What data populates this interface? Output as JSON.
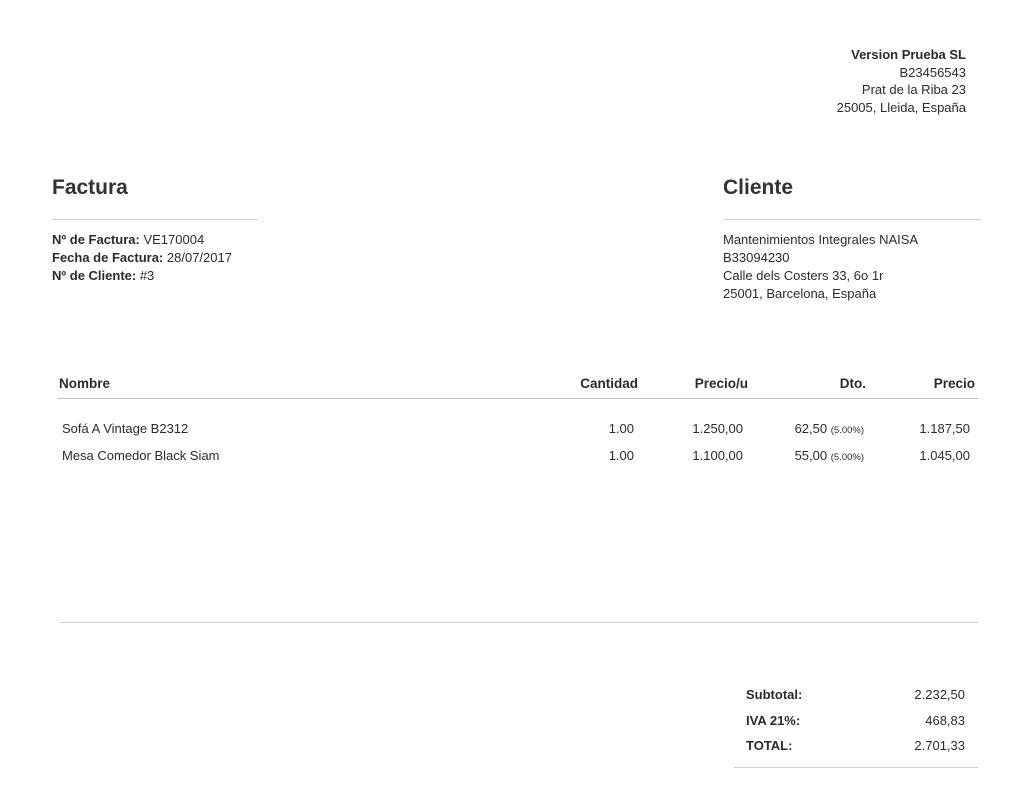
{
  "company": {
    "name": "Version Prueba SL",
    "tax_id": "B23456543",
    "address": "Prat de la Riba 23",
    "city_line": "25005, Lleida, España"
  },
  "invoice": {
    "title": "Factura",
    "number_label": "Nº de Factura:",
    "number": "VE170004",
    "date_label": "Fecha de Factura:",
    "date": "28/07/2017",
    "client_no_label": "Nº de Cliente:",
    "client_no": "#3"
  },
  "client": {
    "title": "Cliente",
    "name": "Mantenimientos Integrales NAISA",
    "tax_id": "B33094230",
    "address": "Calle dels Costers 33, 6o 1r",
    "city_line": "25001, Barcelona, España"
  },
  "table": {
    "headers": {
      "name": "Nombre",
      "qty": "Cantidad",
      "unit_price": "Precio/u",
      "discount": "Dto.",
      "price": "Precio"
    },
    "rows": [
      {
        "name": "Sofá A Vintage B2312",
        "qty": "1.00",
        "unit_price": "1.250,00",
        "discount": "62,50",
        "discount_pct": "(5.00%)",
        "price": "1.187,50"
      },
      {
        "name": "Mesa Comedor Black Siam",
        "qty": "1.00",
        "unit_price": "1.100,00",
        "discount": "55,00",
        "discount_pct": "(5.00%)",
        "price": "1.045,00"
      }
    ]
  },
  "totals": {
    "subtotal_label": "Subtotal:",
    "subtotal": "2.232,50",
    "tax_label": "IVA 21%:",
    "tax": "468,83",
    "total_label": "TOTAL:",
    "total": "2.701,33"
  }
}
